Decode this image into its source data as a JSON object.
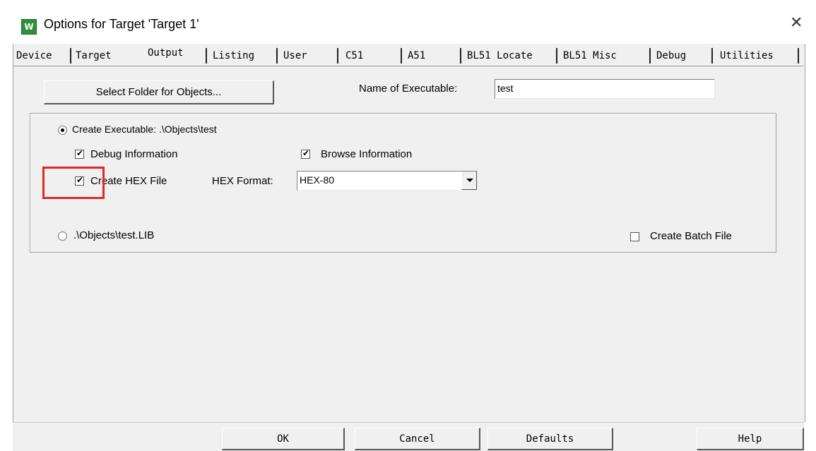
{
  "window": {
    "title": "Options for Target 'Target 1'",
    "app_icon": "keil-uvision-icon",
    "close_icon": "close-icon"
  },
  "tabs": [
    {
      "label": "Device",
      "active": false
    },
    {
      "label": "Target",
      "active": false
    },
    {
      "label": "Output",
      "active": true
    },
    {
      "label": "Listing",
      "active": false
    },
    {
      "label": "User",
      "active": false
    },
    {
      "label": "C51",
      "active": false
    },
    {
      "label": "A51",
      "active": false
    },
    {
      "label": "BL51 Locate",
      "active": false
    },
    {
      "label": "BL51 Misc",
      "active": false
    },
    {
      "label": "Debug",
      "active": false
    },
    {
      "label": "Utilities",
      "active": false
    }
  ],
  "output": {
    "select_folder_label": "Select Folder for Objects...",
    "name_of_executable_label": "Name of Executable:",
    "name_of_executable_value": "test",
    "create_executable_label": "Create Executable:  .\\Objects\\test",
    "create_executable_selected": true,
    "debug_information_label": "Debug Information",
    "debug_information_checked": true,
    "browse_information_label": "Browse Information",
    "browse_information_checked": true,
    "create_hex_label": "Create HEX File",
    "create_hex_checked": true,
    "hex_format_label": "HEX Format:",
    "hex_format_value": "HEX-80",
    "create_library_label": ".\\Objects\\test.LIB",
    "create_library_selected": false,
    "create_batch_label": "Create Batch File",
    "create_batch_checked": false
  },
  "buttons": {
    "ok": "OK",
    "cancel": "Cancel",
    "defaults": "Defaults",
    "help": "Help"
  },
  "highlight_color": "#e02828"
}
